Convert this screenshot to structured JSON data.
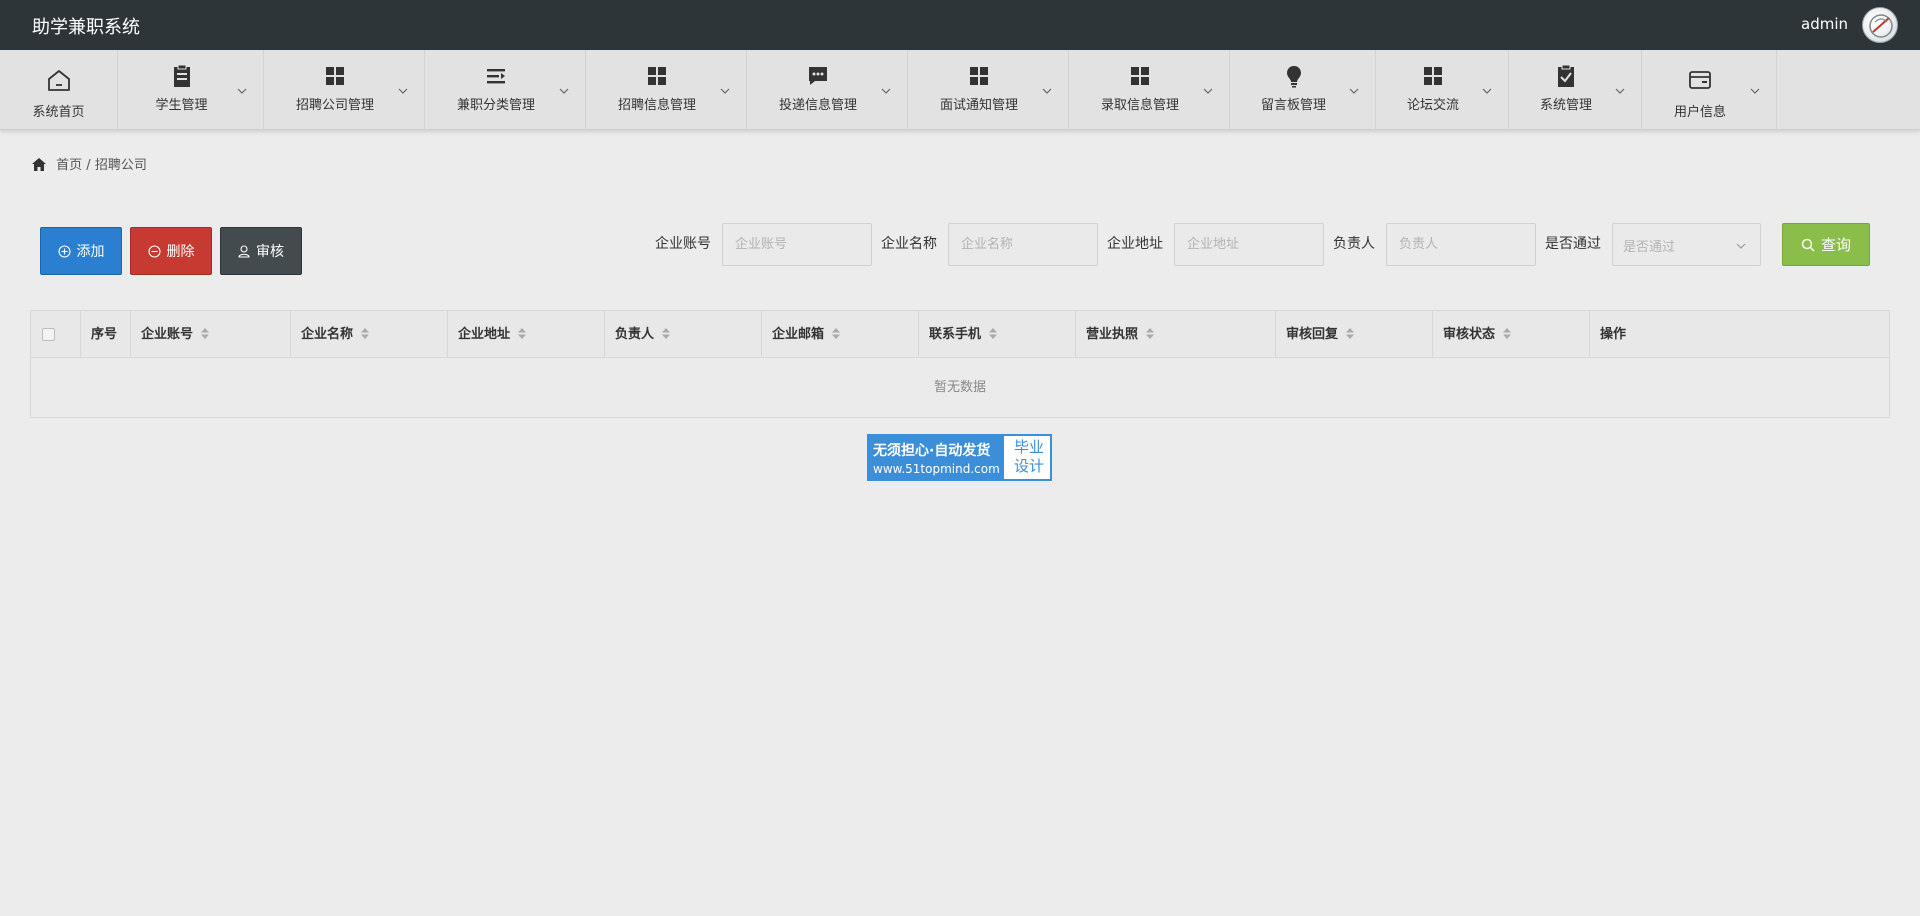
{
  "app": {
    "title": "助学兼职系统",
    "user": "admin"
  },
  "nav": [
    {
      "label": "系统首页",
      "icon": "home-icon",
      "sub": false
    },
    {
      "label": "学生管理",
      "icon": "clipboard-icon",
      "sub": true
    },
    {
      "label": "招聘公司管理",
      "icon": "grid-icon",
      "sub": true
    },
    {
      "label": "兼职分类管理",
      "icon": "list-icon",
      "sub": true
    },
    {
      "label": "招聘信息管理",
      "icon": "grid-icon",
      "sub": true
    },
    {
      "label": "投递信息管理",
      "icon": "chat-icon",
      "sub": true
    },
    {
      "label": "面试通知管理",
      "icon": "grid-icon",
      "sub": true
    },
    {
      "label": "录取信息管理",
      "icon": "grid-icon",
      "sub": true
    },
    {
      "label": "留言板管理",
      "icon": "bulb-icon",
      "sub": true
    },
    {
      "label": "论坛交流",
      "icon": "grid-icon",
      "sub": true
    },
    {
      "label": "系统管理",
      "icon": "clipboard-check-icon",
      "sub": true
    },
    {
      "label": "用户信息",
      "icon": "wallet-icon",
      "sub": true
    }
  ],
  "breadcrumb": {
    "home": "首页",
    "separator": "/",
    "current": "招聘公司"
  },
  "actions": {
    "add": "添加",
    "delete": "删除",
    "audit": "审核",
    "search": "查询"
  },
  "filters": {
    "account": {
      "label": "企业账号",
      "placeholder": "企业账号"
    },
    "name": {
      "label": "企业名称",
      "placeholder": "企业名称"
    },
    "address": {
      "label": "企业地址",
      "placeholder": "企业地址"
    },
    "manager": {
      "label": "负责人",
      "placeholder": "负责人"
    },
    "passed": {
      "label": "是否通过",
      "placeholder": "是否通过"
    }
  },
  "table": {
    "columns": [
      "序号",
      "企业账号",
      "企业名称",
      "企业地址",
      "负责人",
      "企业邮箱",
      "联系手机",
      "营业执照",
      "审核回复",
      "审核状态",
      "操作"
    ],
    "empty": "暂无数据"
  },
  "watermark": {
    "line1": "无须担心·自动发货",
    "line2": "www.51topmind.com",
    "right1": "毕业",
    "right2": "设计"
  },
  "colors": {
    "topbar": "#2e3538",
    "add": "#2a7fd0",
    "delete": "#c63a31",
    "audit": "#444b4f",
    "search": "#8bbd4b",
    "watermark": "#3c8ed8"
  }
}
